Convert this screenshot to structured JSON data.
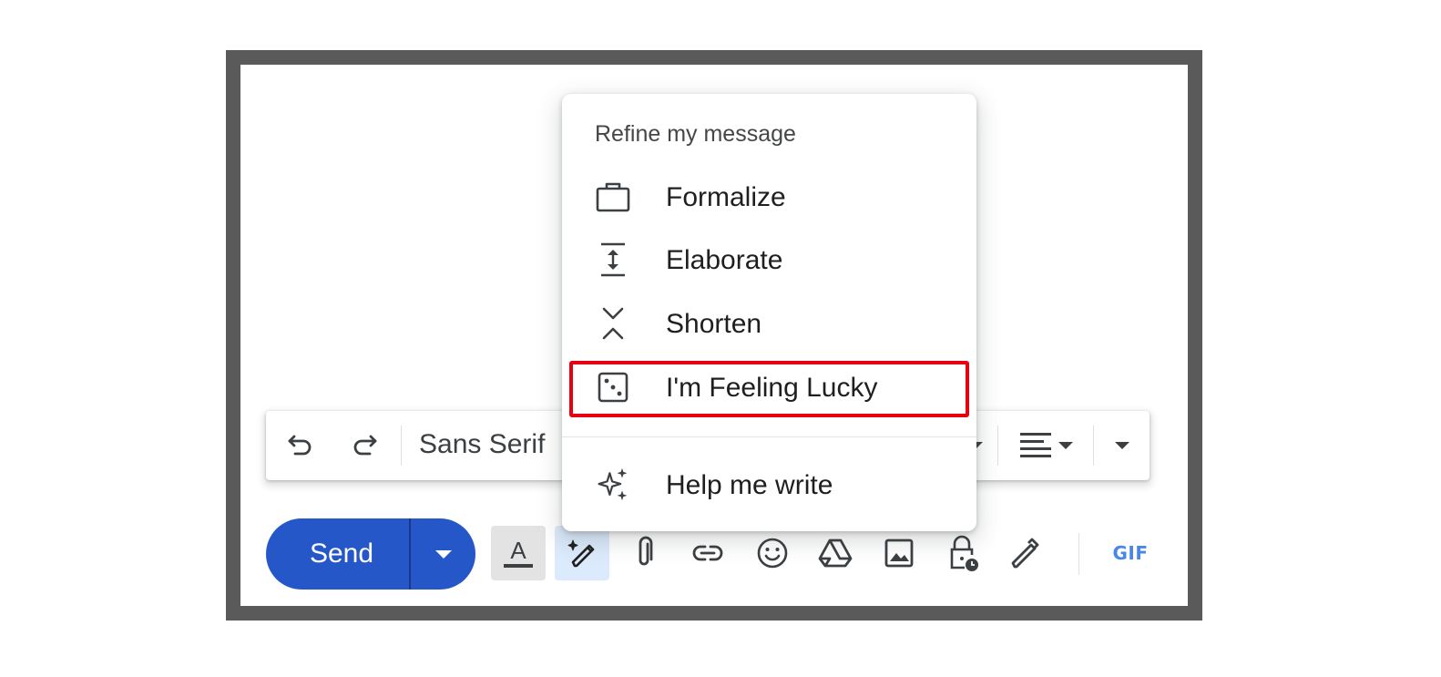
{
  "refine_menu": {
    "title": "Refine my message",
    "items": [
      {
        "label": "Formalize",
        "icon": "briefcase-icon"
      },
      {
        "label": "Elaborate",
        "icon": "expand-vertical-icon"
      },
      {
        "label": "Shorten",
        "icon": "collapse-vertical-icon"
      },
      {
        "label": "I'm Feeling Lucky",
        "icon": "dice-icon",
        "highlighted": true
      },
      {
        "label": "Help me write",
        "icon": "sparkle-icon"
      }
    ]
  },
  "format_toolbar": {
    "font": "Sans Serif",
    "buttons": [
      "undo-icon",
      "redo-icon",
      "align-icon",
      "more-formatting-icon"
    ]
  },
  "compose_bar": {
    "send_label": "Send",
    "gif_label": "GIF",
    "buttons": [
      "formatting-options-icon",
      "help-me-write-icon",
      "attach-icon",
      "link-icon",
      "emoji-icon",
      "drive-icon",
      "photo-icon",
      "confidential-mode-icon",
      "signature-icon",
      "gif-icon"
    ]
  },
  "colors": {
    "send_button": "#2557c9",
    "highlight_border": "#e80010",
    "frame": "#5a5a5a",
    "help_me_write_active": "#dbeafc"
  }
}
